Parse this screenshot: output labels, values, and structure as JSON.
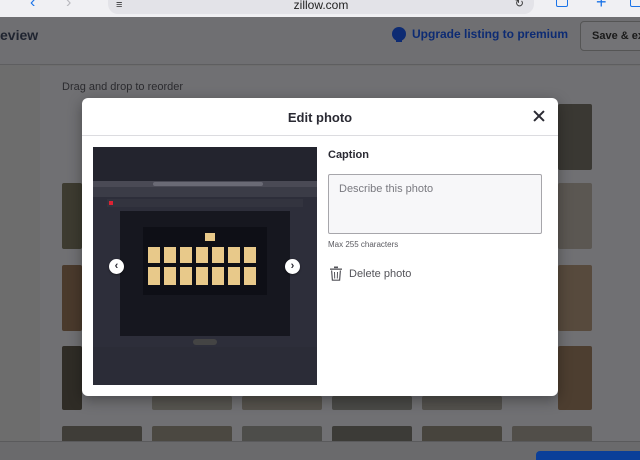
{
  "browser": {
    "url": "zillow.com"
  },
  "header": {
    "title": "eview",
    "upgrade_label": "Upgrade listing to premium",
    "save_label": "Save & ex"
  },
  "main": {
    "reorder_hint": "Drag and drop to reorder"
  },
  "modal": {
    "title": "Edit photo",
    "caption_label": "Caption",
    "caption_placeholder": "Describe this photo",
    "caption_value": "",
    "max_chars": "Max 255 characters",
    "delete_label": "Delete photo",
    "prev_arrow": "‹",
    "next_arrow": "›"
  },
  "colors": {
    "brand": "#0d2b73",
    "overlay": "#6d6d6d",
    "primary_button": "#0b3f99"
  },
  "icons": [
    "back-icon",
    "forward-icon",
    "menu-icon",
    "reload-icon",
    "share-icon",
    "new-tab-icon",
    "tabs-icon",
    "upgrade-badge-icon",
    "close-icon",
    "chevron-left-icon",
    "chevron-right-icon",
    "trash-icon"
  ]
}
